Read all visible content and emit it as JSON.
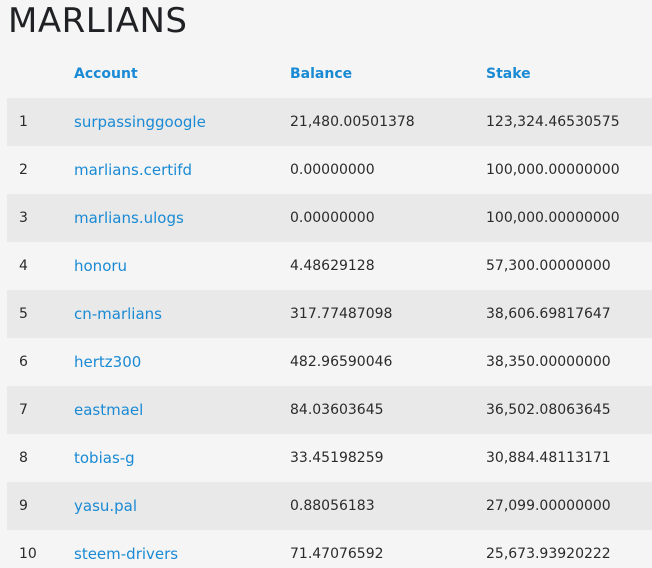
{
  "page": {
    "title": "MARLIANS"
  },
  "table": {
    "headers": {
      "rank": "",
      "account": "Account",
      "balance": "Balance",
      "stake": "Stake"
    },
    "rows": [
      {
        "rank": "1",
        "account": "surpassinggoogle",
        "balance": "21,480.00501378",
        "stake": "123,324.46530575"
      },
      {
        "rank": "2",
        "account": "marlians.certifd",
        "balance": "0.00000000",
        "stake": "100,000.00000000"
      },
      {
        "rank": "3",
        "account": "marlians.ulogs",
        "balance": "0.00000000",
        "stake": "100,000.00000000"
      },
      {
        "rank": "4",
        "account": "honoru",
        "balance": "4.48629128",
        "stake": "57,300.00000000"
      },
      {
        "rank": "5",
        "account": "cn-marlians",
        "balance": "317.77487098",
        "stake": "38,606.69817647"
      },
      {
        "rank": "6",
        "account": "hertz300",
        "balance": "482.96590046",
        "stake": "38,350.00000000"
      },
      {
        "rank": "7",
        "account": "eastmael",
        "balance": "84.03603645",
        "stake": "36,502.08063645"
      },
      {
        "rank": "8",
        "account": "tobias-g",
        "balance": "33.45198259",
        "stake": "30,884.48113171"
      },
      {
        "rank": "9",
        "account": "yasu.pal",
        "balance": "0.88056183",
        "stake": "27,099.00000000"
      },
      {
        "rank": "10",
        "account": "steem-drivers",
        "balance": "71.47076592",
        "stake": "25,673.93920222"
      }
    ]
  },
  "colors": {
    "link": "#1a8ad4",
    "row_stripe": "#e9e9e9",
    "background": "#f5f5f5"
  }
}
